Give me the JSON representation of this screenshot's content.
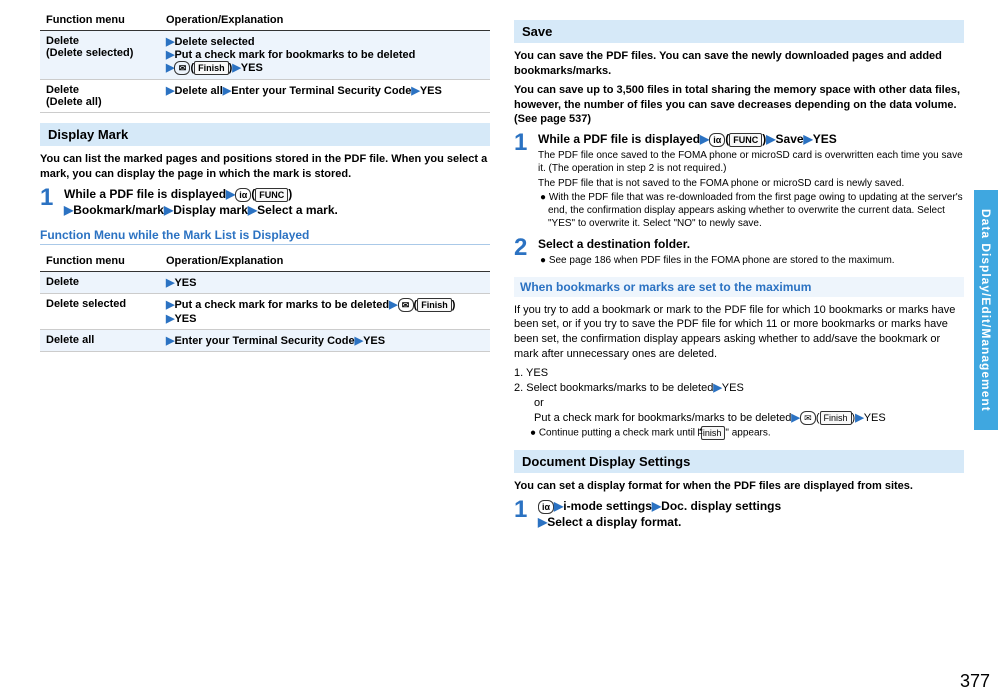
{
  "left": {
    "table1": {
      "headers": [
        "Function menu",
        "Operation/Explanation"
      ],
      "rows": [
        {
          "name": "Delete\n(Delete selected)",
          "op_parts": [
            "▶",
            "Delete selected",
            "\n▶",
            "Put a check mark for bookmarks to be deleted",
            "\n▶",
            "✉",
            "(",
            "Finish",
            ")",
            "▶",
            "YES"
          ]
        },
        {
          "name": "Delete\n(Delete all)",
          "op_parts": [
            "▶",
            "Delete all",
            "▶",
            "Enter your Terminal Security Code",
            "▶",
            "YES"
          ]
        }
      ]
    },
    "displayMark": {
      "title": "Display Mark",
      "intro": "You can list the marked pages and positions stored in the PDF file. When you select a mark, you can display the page in which the mark is stored.",
      "step1_parts": [
        "While a PDF file is displayed",
        "▶",
        "iα",
        "(",
        "FUNC",
        ")",
        "\n▶",
        "Bookmark/mark",
        "▶",
        "Display mark",
        "▶",
        "Select a mark."
      ]
    },
    "funcMenuTitle": "Function Menu while the Mark List is Displayed",
    "table2": {
      "headers": [
        "Function menu",
        "Operation/Explanation"
      ],
      "rows": [
        {
          "name": "Delete",
          "op_parts": [
            "▶",
            "YES"
          ]
        },
        {
          "name": "Delete selected",
          "op_parts": [
            "▶",
            "Put a check mark for marks to be deleted",
            "▶",
            "✉",
            "(",
            "Finish",
            ")",
            "\n▶",
            "YES"
          ]
        },
        {
          "name": "Delete all",
          "op_parts": [
            "▶",
            "Enter your Terminal Security Code",
            "▶",
            "YES"
          ]
        }
      ]
    }
  },
  "right": {
    "save": {
      "title": "Save",
      "intro1": "You can save the PDF files. You can save the newly downloaded pages and added bookmarks/marks.",
      "intro2": "You can save up to 3,500 files in total sharing the memory space with other data files, however, the number of files you can save decreases depending on the data volume. (See page 537)",
      "step1_lead_parts": [
        "While a PDF file is displayed",
        "▶",
        "iα",
        "(",
        "FUNC",
        ")",
        "▶",
        "Save",
        "▶",
        "YES"
      ],
      "step1_sub1": "The PDF file once saved to the FOMA phone or microSD card is overwritten each time you save it. (The operation in step 2 is not required.)",
      "step1_sub2": "The PDF file that is not saved to the FOMA phone or microSD card is newly saved.",
      "step1_bullet": "With the PDF file that was re-downloaded from the first page owing to updating at the server's end, the confirmation display appears asking whether to overwrite the current data. Select \"YES\" to overwrite it. Select \"NO\" to newly save.",
      "step2_lead": "Select a destination folder.",
      "step2_bullet": "See page 186 when PDF files in the FOMA phone are stored to the maximum."
    },
    "maxHead": "When bookmarks or marks are set to the maximum",
    "maxIntro": "If you try to add a bookmark or mark to the PDF file for which 10 bookmarks or marks have been set, or if you try to save the PDF file for which 11 or more bookmarks or marks have been set, the confirmation display appears asking whether to add/save the bookmark or mark after unnecessary ones are deleted.",
    "maxList": {
      "l1": "1. YES",
      "l2a": "2. Select bookmarks/marks to be deleted",
      "l2a_tri": "▶",
      "l2a_end": "YES",
      "or": "or",
      "l2b_start": "Put a check mark for bookmarks/marks to be deleted",
      "l2b_parts": [
        "▶",
        "✉",
        "(",
        "Finish",
        ")",
        "▶",
        "YES"
      ],
      "bullet": "Continue putting a check mark until \"",
      "bullet_icon": "Finish",
      "bullet_end": "\" appears."
    },
    "docDisp": {
      "title": "Document Display Settings",
      "intro": "You can set a display format for when the PDF files are displayed from sites.",
      "step1_parts": [
        "iα",
        "▶",
        "i-mode settings",
        "▶",
        "Doc. display settings",
        "\n▶",
        "Select a display format."
      ]
    }
  },
  "sideTab": "Data Display/Edit/Management",
  "pageNum": "377"
}
